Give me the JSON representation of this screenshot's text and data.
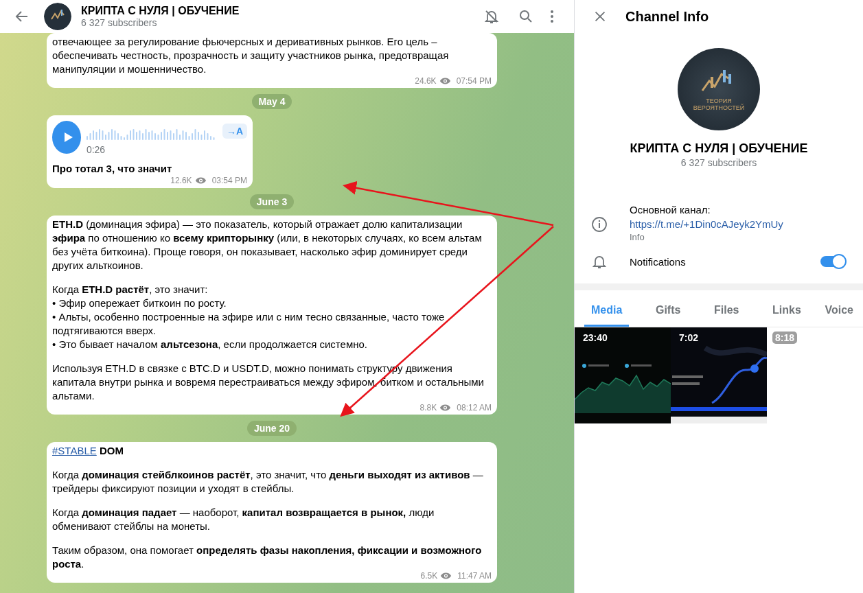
{
  "chat": {
    "title": "КРИПТА С НУЛЯ | ОБУЧЕНИЕ",
    "subtitle": "6 327 subscribers",
    "items": [
      {
        "kind": "text",
        "blocks": [
          [
            "отвечающее за регулирование фьючерсных и деривативных рынков. Его цель – обеспечивать честность, прозрачность и защиту участников рынка, предотвращая манипуляции и мошенничество."
          ]
        ],
        "views": "24.6K",
        "time": "07:54 PM"
      },
      {
        "kind": "date",
        "label": "May 4"
      },
      {
        "kind": "voice",
        "duration": "0:26",
        "transcribe": "→A",
        "caption": "Про тотал 3, что значит",
        "views": "12.6K",
        "time": "03:54 PM"
      },
      {
        "kind": "date",
        "label": "June 3"
      },
      {
        "kind": "text",
        "blocks": [
          [
            "**ETH.D** (доминация эфира) — это показатель, который отражает долю капитализации **эфира** по отношению ко **всему крипторынку** (или, в некоторых случаях, ко всем альтам без учёта биткоина). Проще говоря, он показывает, насколько эфир доминирует среди других альткоинов."
          ],
          [
            "Когда **ETH.D растёт**, это значит:",
            "• Эфир опережает биткоин по росту.",
            "• Альты, особенно построенные на эфире или с ним тесно связанные, часто тоже подтягиваются вверх.",
            "• Это бывает началом **альтсезона**, если продолжается системно."
          ],
          [
            "Используя ETH.D в связке с BTC.D и USDT.D, можно понимать структуру движения капитала внутри рынка и вовремя перестраиваться между эфиром, битком и остальными альтами."
          ]
        ],
        "views": "8.8K",
        "time": "08:12 AM"
      },
      {
        "kind": "date",
        "label": "June 20"
      },
      {
        "kind": "text",
        "hashtag": "#STABLE",
        "headline": "DOM",
        "blocks": [
          [
            "Когда **доминация стейблкоинов растёт**, это значит, что **деньги выходят из активов** — трейдеры фиксируют позиции и уходят в стейблы."
          ],
          [
            "Когда **доминация падает** — наоборот, **капитал возвращается в рынок,** люди обменивают стейблы на монеты."
          ],
          [
            "Таким образом, она помогает **определять фазы накопления, фиксации и возможного роста**."
          ]
        ],
        "views": "6.5K",
        "time": "11:47 AM"
      }
    ]
  },
  "info": {
    "title": "Channel Info",
    "avatar_lines": [
      "ТЕОРИЯ",
      "ВЕРОЯТНОСТЕЙ"
    ],
    "name": "КРИПТА С НУЛЯ | ОБУЧЕНИЕ",
    "subscribers": "6 327 subscribers",
    "description": "Основной канал:",
    "link": "https://t.me/+1Din0cAJeyk2YmUy",
    "description_label": "Info",
    "notifications": {
      "label": "Notifications",
      "on": true
    },
    "tabs": [
      {
        "label": "Media",
        "selected": true
      },
      {
        "label": "Gifts",
        "selected": false
      },
      {
        "label": "Files",
        "selected": false
      },
      {
        "label": "Links",
        "selected": false
      },
      {
        "label": "Voice",
        "selected": false
      }
    ],
    "media": [
      {
        "kind": "chart",
        "duration": "23:40"
      },
      {
        "kind": "wave",
        "duration": "7:02"
      },
      {
        "kind": "blank",
        "duration": "8:18"
      }
    ]
  }
}
